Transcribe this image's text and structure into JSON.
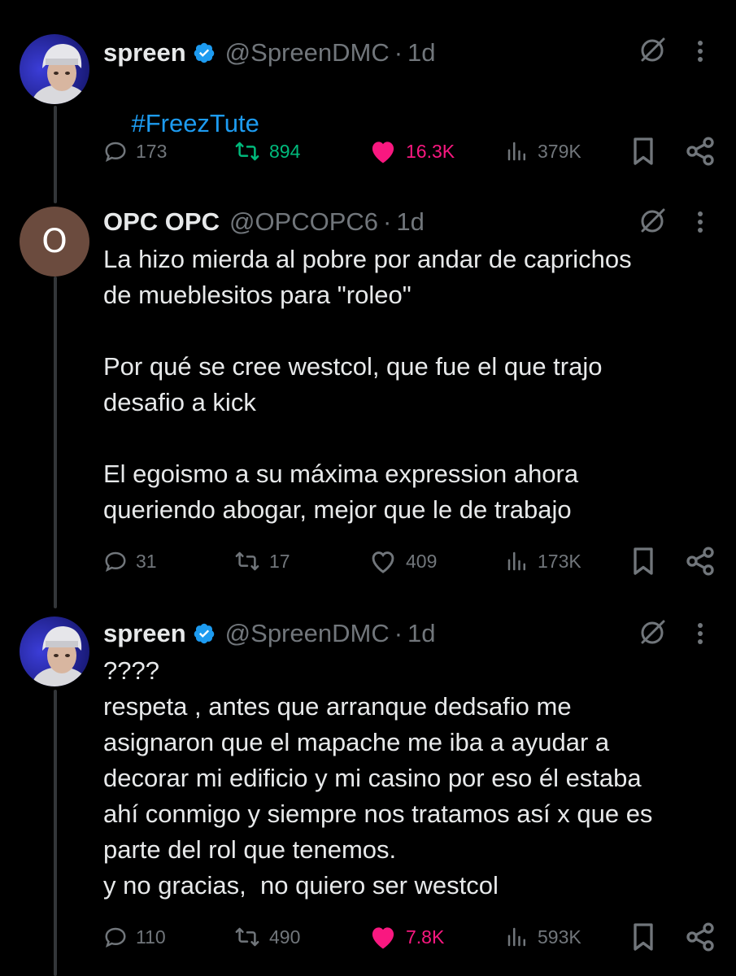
{
  "colors": {
    "background": "#000000",
    "text_primary": "#e7e9ea",
    "text_secondary": "#71767b",
    "link": "#1d9bf0",
    "retweet": "#00ba7c",
    "like": "#f91880",
    "verified": "#1d9bf0"
  },
  "tweets": [
    {
      "name": "spreen",
      "verified": true,
      "handle": "@SpreenDMC",
      "separator": "·",
      "time": "1d",
      "avatar": "profile-photo",
      "text": "#FreezTute",
      "stats": {
        "replies": "173",
        "retweets": "894",
        "likes": "16.3K",
        "views": "379K"
      },
      "retweeted": true,
      "liked": true
    },
    {
      "name": "OPC OPC",
      "verified": false,
      "handle": "@OPCOPC6",
      "separator": "·",
      "time": "1d",
      "avatar_letter": "O",
      "text": "La hizo mierda al pobre por andar de caprichos\nde mueblesitos para \"roleo\"\n\nPor qué se cree westcol, que fue el que trajo\ndesafio a kick\n\nEl egoismo a su máxima expression ahora\nqueriendo abogar, mejor que le de trabajo",
      "stats": {
        "replies": "31",
        "retweets": "17",
        "likes": "409",
        "views": "173K"
      },
      "retweeted": false,
      "liked": false
    },
    {
      "name": "spreen",
      "verified": true,
      "handle": "@SpreenDMC",
      "separator": "·",
      "time": "1d",
      "avatar": "profile-photo",
      "text": "????\nrespeta , antes que arranque dedsafio me\nasignaron que el mapache me iba a ayudar a\ndecorar mi edificio y mi casino por eso él estaba\nahí conmigo y siempre nos tratamos así x que es\nparte del rol que tenemos.\ny no gracias,  no quiero ser westcol",
      "stats": {
        "replies": "110",
        "retweets": "490",
        "likes": "7.8K",
        "views": "593K"
      },
      "retweeted": false,
      "liked": true
    }
  ],
  "icons": {
    "reply": "reply-bubble-icon",
    "retweet": "retweet-icon",
    "like": "heart-icon",
    "views": "views-bar-chart-icon",
    "bookmark": "bookmark-icon",
    "share": "share-icon",
    "grok": "grok-icon",
    "more": "more-vertical-icon",
    "verified": "verified-badge-icon"
  }
}
